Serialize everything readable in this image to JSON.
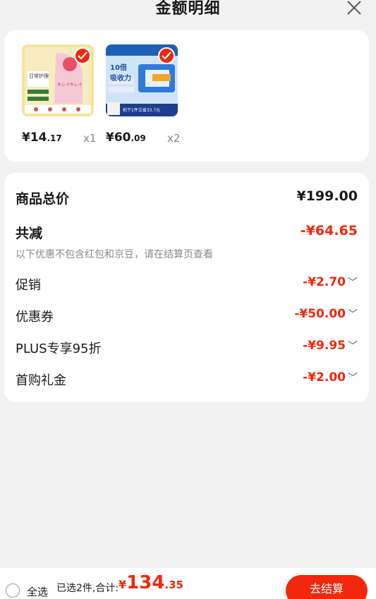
{
  "header": {
    "title": "金额明细"
  },
  "products": [
    {
      "price_int": "¥14",
      "price_dec": ".17",
      "qty": "x1",
      "thumb_title": "日常护理",
      "thumb_sub": "キレイキレイ"
    },
    {
      "price_int": "¥60",
      "price_dec": ".09",
      "qty": "x2",
      "thumb_title": "10倍 吸收力",
      "thumb_sub": "拍下1件立省33.7元"
    }
  ],
  "details": {
    "subtotal_label": "商品总价",
    "subtotal_value": "¥199.00",
    "discount_label": "共减",
    "discount_value": "-¥64.65",
    "note": "以下优惠不包含红包和京豆，请在结算页查看",
    "items": [
      {
        "label": "促销",
        "value": "-¥2.70"
      },
      {
        "label": "优惠券",
        "value": "-¥50.00"
      },
      {
        "label": "PLUS专享95折",
        "value": "-¥9.95"
      },
      {
        "label": "首购礼金",
        "value": "-¥2.00"
      }
    ]
  },
  "footer": {
    "select_all": "全选",
    "summary": "已选2件,合计:",
    "total_sym": "¥",
    "total_int": "134",
    "total_dec": ".35",
    "checkout": "去结算"
  },
  "colors": {
    "accent": "#f2270c"
  }
}
